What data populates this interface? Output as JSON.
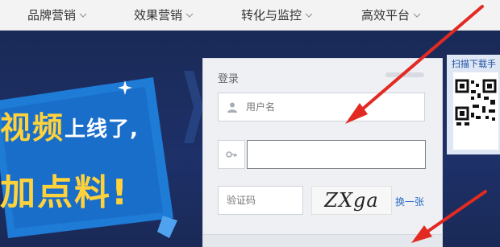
{
  "nav": {
    "items": [
      {
        "label": "品牌营销"
      },
      {
        "label": "效果营销"
      },
      {
        "label": "转化与监控"
      },
      {
        "label": "高效平台"
      }
    ]
  },
  "hero": {
    "slogan_line1_big": "视频",
    "slogan_line1_small": "上线了,",
    "slogan_line2": "加点料!"
  },
  "login": {
    "title": "登录",
    "username_placeholder": "用户名",
    "captcha_placeholder": "验证码",
    "captcha_text": "ZXga",
    "refresh_label": "换一张"
  },
  "qr": {
    "label": "扫描下载手"
  },
  "colors": {
    "nav_bg": "#f3f3f3",
    "hero_bg": "#1b2a55",
    "slogan_yellow": "#ffd23c",
    "link_blue": "#2b6cc2",
    "arrow_red": "#e22a22"
  }
}
